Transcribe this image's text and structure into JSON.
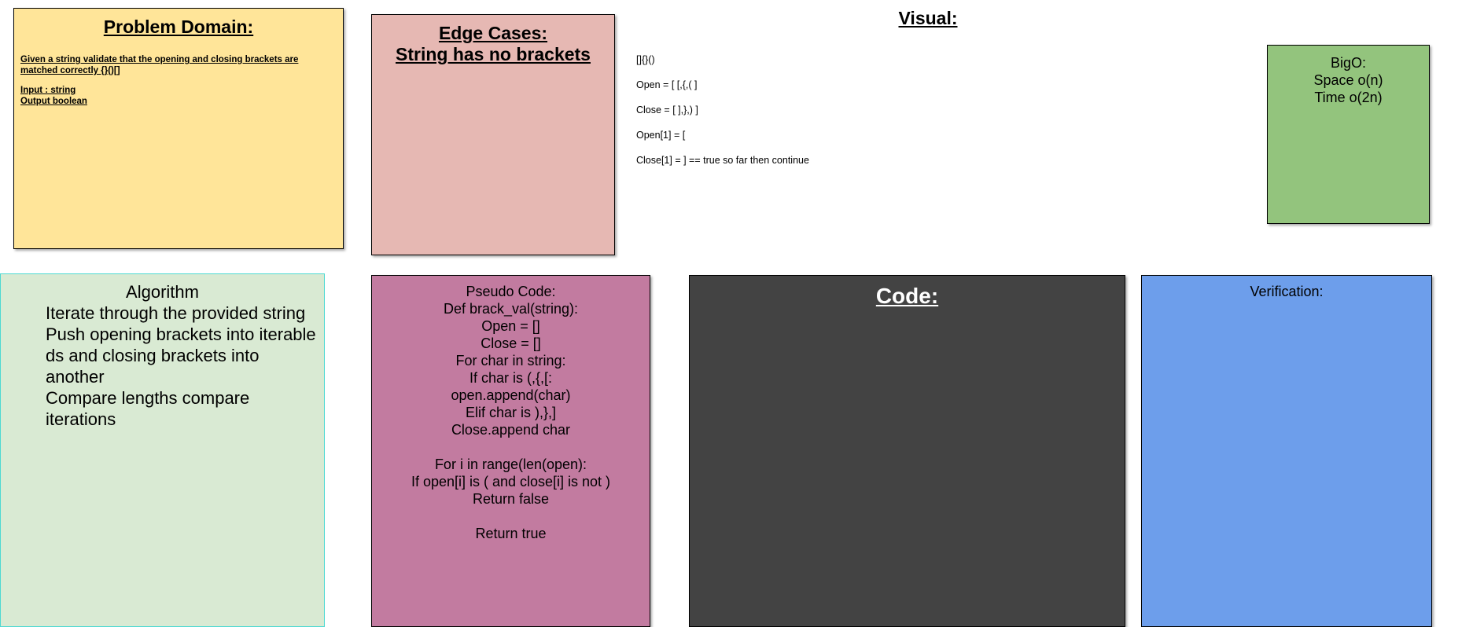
{
  "problem": {
    "title": "Problem Domain:",
    "description": "Given a string validate that the opening and closing brackets are matched correctly {}()[]",
    "input": "Input : string",
    "output": "Output boolean"
  },
  "edge_cases": {
    "title_line1": "Edge Cases:",
    "title_line2": "String has no brackets"
  },
  "visual": {
    "title": "Visual:",
    "lines": [
      "[]{}()",
      "Open = [ [,{,( ]",
      "Close = [ ],},) ]",
      "Open[1] = [",
      "Close[1] = ]  == true so far then continue"
    ]
  },
  "bigo": {
    "title": "BigO:",
    "space": "Space o(n)",
    "time": "Time o(2n)"
  },
  "algorithm": {
    "title": "Algorithm",
    "steps": [
      "Iterate through the provided string",
      "Push opening brackets into iterable ds and closing brackets into another",
      "Compare lengths compare iterations"
    ]
  },
  "pseudo": {
    "lines": [
      "Pseudo Code:",
      "Def brack_val(string):",
      "Open = []",
      "Close = []",
      "For char in string:",
      "If char is (,{,[:",
      "open.append(char)",
      "Elif char is ),},]",
      "Close.append char",
      "",
      "For i in range(len(open):",
      "If open[i] is ( and close[i] is not )",
      "Return false",
      "",
      "Return true"
    ]
  },
  "code": {
    "title": "Code:"
  },
  "verification": {
    "title": "Verification:"
  }
}
